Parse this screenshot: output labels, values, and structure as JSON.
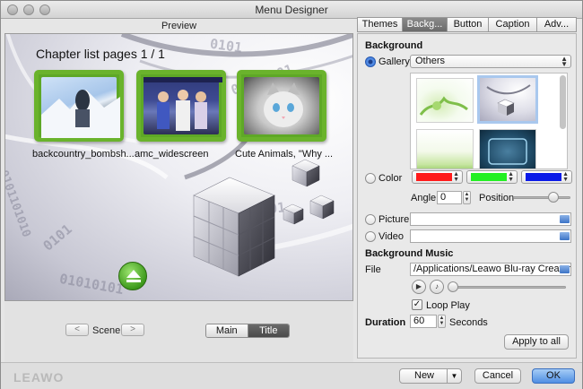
{
  "window": {
    "title": "Menu Designer"
  },
  "preview": {
    "header": "Preview",
    "chapter_title": "Chapter list pages 1 / 1",
    "thumbnails": [
      {
        "label": "backcountry_bombsh..."
      },
      {
        "label": "amc_widescreen"
      },
      {
        "label": "Cute Animals, \"Why ..."
      }
    ],
    "binary_text": [
      "0101",
      "01010101",
      "0101101010",
      "0101",
      "01010101",
      "01010101"
    ]
  },
  "scene": {
    "label": "Scene",
    "prev": "<",
    "next": ">"
  },
  "view_toggle": {
    "options": [
      "Main",
      "Title"
    ],
    "selected": "Title"
  },
  "tabs": [
    {
      "label": "Themes",
      "active": false
    },
    {
      "label": "Backg...",
      "active": true
    },
    {
      "label": "Button",
      "active": false
    },
    {
      "label": "Caption",
      "active": false
    },
    {
      "label": "Adv...",
      "active": false
    }
  ],
  "background": {
    "section_title": "Background",
    "gallery_label": "Gallery",
    "gallery_selected": "Others",
    "gallery_selected_radio": "Gallery",
    "color_label": "Color",
    "colors": [
      "#ff1a1a",
      "#22f022",
      "#0a1ae8"
    ],
    "angle_label": "Angle",
    "angle_value": "0",
    "position_label": "Position",
    "position_value": 0.7,
    "picture_label": "Picture",
    "picture_value": "",
    "video_label": "Video",
    "video_value": ""
  },
  "music": {
    "section_title": "Background Music",
    "file_label": "File",
    "file_value": "/Applications/Leawo Blu-ray Creator",
    "loop_label": "Loop Play",
    "loop_checked": true,
    "duration_label": "Duration",
    "duration_value": "60",
    "duration_unit": "Seconds",
    "apply_label": "Apply to all"
  },
  "footer": {
    "logo": "LEAWO",
    "new_label": "New",
    "cancel_label": "Cancel",
    "ok_label": "OK"
  },
  "accent": "#4f8fe3"
}
